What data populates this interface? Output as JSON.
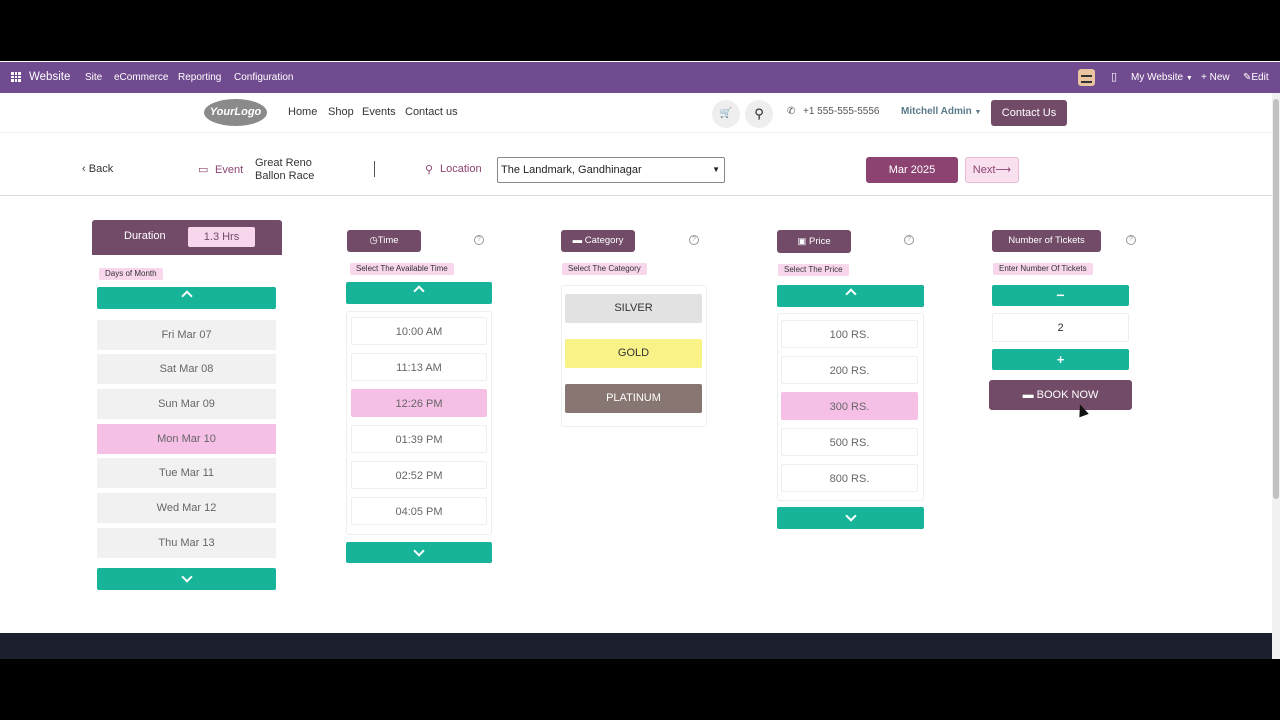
{
  "adminbar": {
    "app_name": "Website",
    "menu": [
      "Site",
      "eCommerce",
      "Reporting",
      "Configuration"
    ],
    "website_selector": "My Website",
    "new_label": "+ New",
    "edit_label": "Edit"
  },
  "site_header": {
    "logo_text": "YourLogo",
    "nav": [
      "Home",
      "Shop",
      "Events",
      "Contact us"
    ],
    "phone": "+1 555-555-5556",
    "user_name": "Mitchell Admin",
    "contact_button": "Contact Us"
  },
  "filters": {
    "back_label": "Back",
    "event_label": "Event",
    "event_name_line1": "Great Reno",
    "event_name_line2": "Ballon Race",
    "location_label": "Location",
    "location_value": "The Landmark, Gandhinagar",
    "month_label": "Mar 2025",
    "next_label": "Next"
  },
  "duration": {
    "label": "Duration",
    "value": "1.3 Hrs",
    "days_label": "Days of Month",
    "days": [
      "Fri Mar 07",
      "Sat Mar 08",
      "Sun Mar 09",
      "Mon Mar 10",
      "Tue Mar 11",
      "Wed Mar 12",
      "Thu Mar 13"
    ],
    "selected_day": "Mon Mar 10"
  },
  "time": {
    "label": "Time",
    "sublabel": "Select The Available Time",
    "slots": [
      "10:00 AM",
      "11:13 AM",
      "12:26 PM",
      "01:39 PM",
      "02:52 PM",
      "04:05 PM"
    ],
    "selected_slot": "12:26 PM"
  },
  "category": {
    "label": "Category",
    "sublabel": "Select The Category",
    "options": [
      "SILVER",
      "GOLD",
      "PLATINUM"
    ],
    "colors": {
      "SILVER": "#e2e2e2",
      "GOLD": "#f8f287",
      "PLATINUM": "#877671"
    }
  },
  "price": {
    "label": "Price",
    "sublabel": "Select The Price",
    "options": [
      "100 RS.",
      "200 RS.",
      "300 RS.",
      "500 RS.",
      "800 RS."
    ],
    "selected_option": "300 RS."
  },
  "tickets": {
    "label": "Number of Tickets",
    "sublabel": "Enter Number Of Tickets",
    "minus": "−",
    "plus": "+",
    "quantity": "2",
    "book_label": "BOOK NOW"
  },
  "colors": {
    "admin_bar": "#714b8f",
    "primary": "#714b67",
    "teal": "#17b49a",
    "selected": "#f5bfe6"
  }
}
